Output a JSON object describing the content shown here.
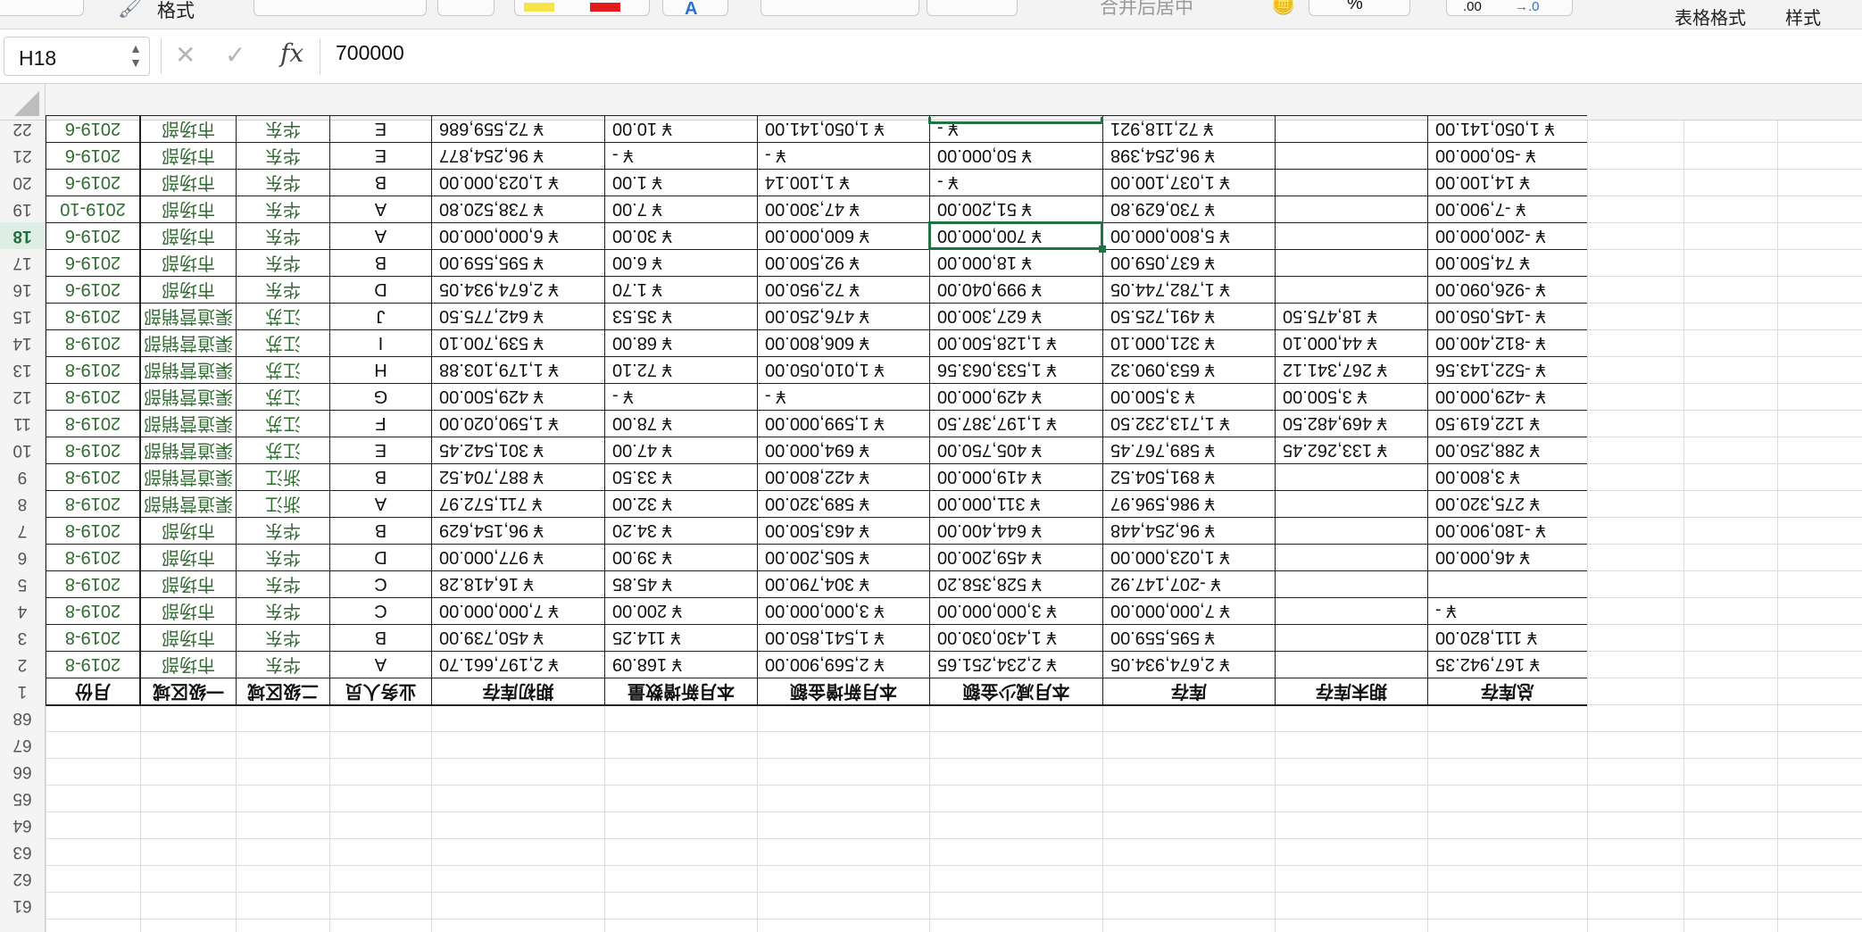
{
  "ribbon": {
    "format_label": "格式",
    "cond_format_label": "表格格式",
    "cell_style_label": "样式",
    "merge_label": "合并后居中",
    "percent_label": "%",
    "inc_decimal_label": ".00",
    "dec_decimal_label": "→.0",
    "fill_color": "#f7e34a",
    "font_color": "#e21b1b"
  },
  "formula_bar": {
    "name_box": "H18",
    "fx_label": "fx",
    "formula": "700000"
  },
  "row_headers": [
    "22",
    "21",
    "20",
    "19",
    "18",
    "17",
    "16",
    "15",
    "14",
    "13",
    "12",
    "11",
    "10",
    "9",
    "8",
    "7",
    "6",
    "5",
    "4",
    "3",
    "2",
    "1",
    "68",
    "67",
    "66",
    "65",
    "64",
    "63",
    "62",
    "61"
  ],
  "selected_row_header": "18",
  "table": {
    "partial_row": [
      "2019-6",
      "市场部",
      "华东",
      "E",
      "¥ 72,559,686",
      "¥ 10.00",
      "¥ 1,050,141.00",
      "¥ -",
      "¥ 72,118,921",
      "",
      "¥ 1,050,141.00"
    ],
    "rows": [
      [
        "2019-6",
        "市场部",
        "华东",
        "E",
        "¥ 96,254,877",
        "¥ -",
        "¥ -",
        "¥ 50,000.00",
        "¥ 96,254,398",
        "",
        "¥ -50,000.00"
      ],
      [
        "2019-6",
        "市场部",
        "华东",
        "B",
        "¥ 1,023,000.00",
        "¥ 1.00",
        "¥ 1,100.14",
        "¥ -",
        "¥ 1,037,100.00",
        "",
        "¥ 14,100.00"
      ],
      [
        "2019-10",
        "市场部",
        "华东",
        "A",
        "¥ 738,520.80",
        "¥ 7.00",
        "¥ 47,300.00",
        "¥ 51,200.00",
        "¥ 730,629.80",
        "",
        "¥ -7,900.00"
      ],
      [
        "2019-6",
        "市场部",
        "华东",
        "A",
        "¥ 6,000,000.00",
        "¥ 30.00",
        "¥ 600,000.00",
        "¥ 700,000.00",
        "¥ 5,800,000.00",
        "",
        "¥ -200,000.00"
      ],
      [
        "2019-6",
        "市场部",
        "华东",
        "B",
        "¥ 595,559.00",
        "¥ 6.00",
        "¥ 92,500.00",
        "¥ 18,000.00",
        "¥ 637,059.00",
        "",
        "¥ 74,500.00"
      ],
      [
        "2019-6",
        "市场部",
        "华东",
        "D",
        "¥ 2,674,934.05",
        "¥ 1.70",
        "¥ 72,950.00",
        "¥ 999,040.00",
        "¥ 1,782,744.05",
        "",
        "¥ -926,090.00"
      ],
      [
        "2019-8",
        "渠道营销部",
        "江苏",
        "J",
        "¥ 642,775.50",
        "¥ 35.53",
        "¥ 476,250.00",
        "¥ 627,300.00",
        "¥ 491,725.50",
        "¥ 18,475.50",
        "¥ -145,050.00"
      ],
      [
        "2019-8",
        "渠道营销部",
        "江苏",
        "I",
        "¥ 539,700.10",
        "¥ 68.00",
        "¥ 606,800.00",
        "¥ 1,128,500.00",
        "¥ 321,000.10",
        "¥ 44,000.10",
        "¥ -812,400.00"
      ],
      [
        "2019-8",
        "渠道营销部",
        "江苏",
        "H",
        "¥ 1,179,103.88",
        "¥ 72.10",
        "¥ 1,010,050.00",
        "¥ 1,533,063.56",
        "¥ 653,090.32",
        "¥ 267,341.12",
        "¥ -522,143.56"
      ],
      [
        "2019-8",
        "渠道营销部",
        "江苏",
        "G",
        "¥ 429,500.00",
        "¥ -",
        "¥ -",
        "¥ 429,000.00",
        "¥ 3,500.00",
        "¥ 3,500.00",
        "¥ -429,000.00"
      ],
      [
        "2019-8",
        "渠道营销部",
        "江苏",
        "F",
        "¥ 1,590,020.00",
        "¥ 78.00",
        "¥ 1,599,000.00",
        "¥ 1,197,387.50",
        "¥ 1,713,232.50",
        "¥ 469,482.50",
        "¥ 122,619.50"
      ],
      [
        "2019-8",
        "渠道营销部",
        "江苏",
        "E",
        "¥ 301,542.45",
        "¥ 47.00",
        "¥ 694,000.00",
        "¥ 405,750.00",
        "¥ 589,767.45",
        "¥ 133,262.45",
        "¥ 288,250.00"
      ],
      [
        "2019-8",
        "渠道营销部",
        "浙江",
        "B",
        "¥ 887,704.52",
        "¥ 33.50",
        "¥ 422,800.00",
        "¥ 419,000.00",
        "¥ 891,504.52",
        "",
        "¥ 3,800.00"
      ],
      [
        "2019-8",
        "渠道营销部",
        "浙江",
        "A",
        "¥ 711,572.97",
        "¥ 32.00",
        "¥ 589,320.00",
        "¥ 311,000.00",
        "¥ 986,596.97",
        "",
        "¥ 275,320.00"
      ],
      [
        "2019-8",
        "市场部",
        "华东",
        "B",
        "¥ 96,154,629",
        "¥ 34.20",
        "¥ 463,500.00",
        "¥ 644,400.00",
        "¥ 96,254,448",
        "",
        "¥ -180,900.00"
      ],
      [
        "2019-8",
        "市场部",
        "华东",
        "D",
        "¥ 977,000.00",
        "¥ 39.00",
        "¥ 505,200.00",
        "¥ 459,200.00",
        "¥ 1,023,000.00",
        "",
        "¥ 46,000.00"
      ],
      [
        "2019-8",
        "市场部",
        "华东",
        "C",
        "¥ 16,418.28",
        "¥ 45.85",
        "¥ 304,790.00",
        "¥ 528,358.20",
        "¥ -207,147.92",
        "",
        ""
      ],
      [
        "2019-8",
        "市场部",
        "华东",
        "C",
        "¥ 7,000,000.00",
        "¥ 200.00",
        "¥ 3,000,000.00",
        "¥ 3,000,000.00",
        "¥ 7,000,000.00",
        "",
        "¥ -"
      ],
      [
        "2019-8",
        "市场部",
        "华东",
        "B",
        "¥ 450,739.00",
        "¥ 114.25",
        "¥ 1,541,850.00",
        "¥ 1,430,030.00",
        "¥ 595,559.00",
        "",
        "¥ 111,820.00"
      ],
      [
        "2019-8",
        "市场部",
        "华东",
        "A",
        "¥ 2,197,661.70",
        "¥ 168.09",
        "¥ 2,569,900.00",
        "¥ 2,234,251.65",
        "¥ 2,674,934.05",
        "",
        "¥ 167,942.35"
      ]
    ],
    "header": [
      "月份",
      "一级区域",
      "二级区域",
      "业务人员",
      "期初库存",
      "本月新增数量",
      "本月新增金额",
      "本月减少金额",
      "库存",
      "期末库存",
      "总库存"
    ]
  }
}
